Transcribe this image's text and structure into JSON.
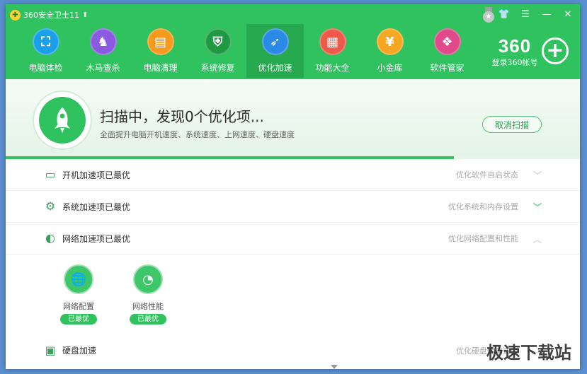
{
  "app": {
    "title": "360安全卫士11"
  },
  "nav": [
    {
      "label": "电脑体检",
      "icon": "monitor-icon",
      "color": "#1aa0e8",
      "glyph": "⛶"
    },
    {
      "label": "木马查杀",
      "icon": "horse-icon",
      "color": "#8a5ae0",
      "glyph": "♞"
    },
    {
      "label": "电脑清理",
      "icon": "broom-icon",
      "color": "#f39a1f",
      "glyph": "▤"
    },
    {
      "label": "系统修复",
      "icon": "shield-icon",
      "color": "#1f9a43",
      "glyph": "⛨"
    },
    {
      "label": "优化加速",
      "icon": "rocket-icon",
      "color": "#2a8ae6",
      "glyph": "➶"
    },
    {
      "label": "功能大全",
      "icon": "grid-icon",
      "color": "#ee5a4a",
      "glyph": "▦"
    },
    {
      "label": "小金库",
      "icon": "money-bag-icon",
      "color": "#f5a623",
      "glyph": "¥"
    },
    {
      "label": "软件管家",
      "icon": "apps-icon",
      "color": "#e04a8a",
      "glyph": "❖"
    }
  ],
  "brand": {
    "logo": "360",
    "login": "登录360帐号"
  },
  "scan": {
    "title": "扫描中，发现0个优化项...",
    "desc": "全面提升电脑开机速度、系统速度、上网速度、硬盘速度",
    "cancel": "取消扫描",
    "progress": 0.78
  },
  "rows": [
    {
      "label": "开机加速项已最优",
      "hint": "优化软件自启状态",
      "icon": "monitor-icon",
      "glyph": "▭",
      "chevron": "﹀"
    },
    {
      "label": "系统加速项已最优",
      "hint": "优化系统和内存设置",
      "icon": "gear-icon",
      "glyph": "⚙",
      "chevron": "﹀"
    },
    {
      "label": "网络加速项已最优",
      "hint": "优化网络配置和性能",
      "icon": "globe-icon",
      "glyph": "◐",
      "chevron": "︿"
    },
    {
      "label": "硬盘加速",
      "hint": "优化硬盘传输速度",
      "icon": "disk-icon",
      "glyph": "▣",
      "chevron": ""
    }
  ],
  "sub_items": [
    {
      "label": "网络配置",
      "badge": "已最优",
      "icon": "globe-icon",
      "glyph": "🌐"
    },
    {
      "label": "网络性能",
      "badge": "已最优",
      "icon": "gauge-icon",
      "glyph": "◔"
    }
  ],
  "watermark": "极速下载站",
  "window_controls": [
    "shirt-icon",
    "menu-icon",
    "minimize-icon",
    "close-icon"
  ]
}
